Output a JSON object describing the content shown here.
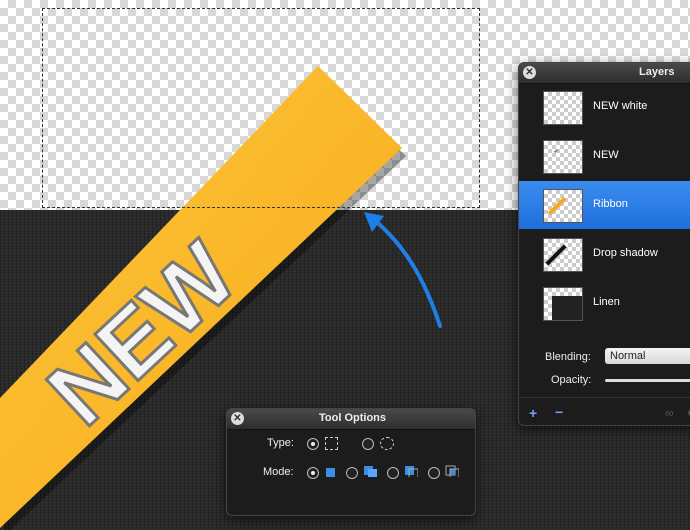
{
  "colors": {
    "ribbon": "#fbb42a",
    "selected_row": "#2a7be6",
    "arrow": "#1f7fe6",
    "panel_bg": "#1c1c1c"
  },
  "canvas": {
    "ribbon_text": "NEW"
  },
  "layers_panel": {
    "title": "Layers",
    "layers": [
      {
        "name": "NEW white",
        "selected": false
      },
      {
        "name": "NEW",
        "selected": false
      },
      {
        "name": "Ribbon",
        "selected": true
      },
      {
        "name": "Drop shadow",
        "selected": false
      },
      {
        "name": "Linen",
        "selected": false
      }
    ],
    "blending_label": "Blending:",
    "blending_value": "Normal",
    "opacity_label": "Opacity:",
    "icons": [
      "add-icon",
      "remove-icon",
      "link-icon",
      "settings-icon"
    ]
  },
  "tool_options": {
    "title": "Tool Options",
    "type_label": "Type:",
    "type_options": [
      "rectangle-selection-icon",
      "ellipse-selection-icon"
    ],
    "type_selected": 0,
    "mode_label": "Mode:",
    "mode_options": [
      "replace-mode-icon",
      "add-mode-icon",
      "subtract-mode-icon",
      "intersect-mode-icon"
    ],
    "mode_selected": 0
  }
}
